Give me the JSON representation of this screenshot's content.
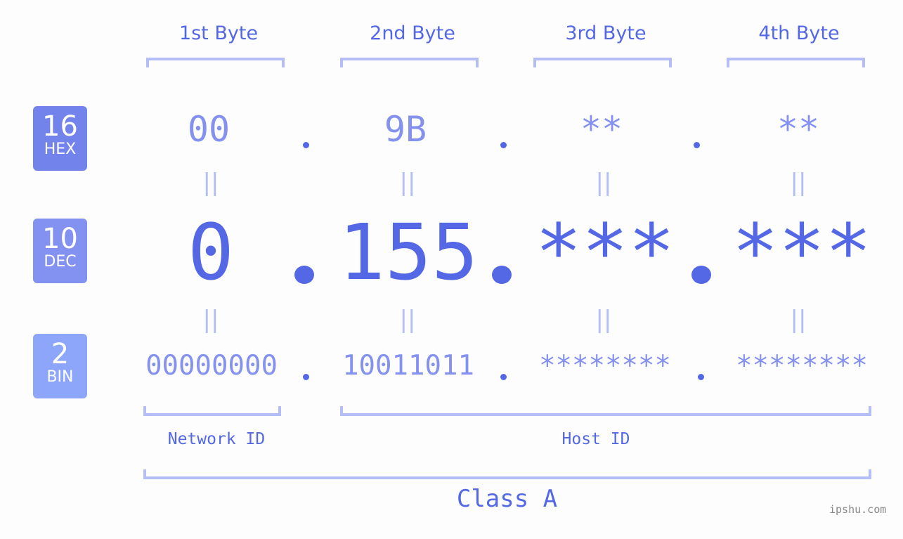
{
  "bytes": [
    {
      "header": "1st Byte",
      "hex": "00",
      "dec": "0",
      "bin": "00000000"
    },
    {
      "header": "2nd Byte",
      "hex": "9B",
      "dec": "155",
      "bin": "10011011"
    },
    {
      "header": "3rd Byte",
      "hex": "**",
      "dec": "***",
      "bin": "********"
    },
    {
      "header": "4th Byte",
      "hex": "**",
      "dec": "***",
      "bin": "********"
    }
  ],
  "badges": {
    "hex": {
      "num": "16",
      "label": "HEX",
      "color": "#7383ec"
    },
    "dec": {
      "num": "10",
      "label": "DEC",
      "color": "#8391f1"
    },
    "bin": {
      "num": "2",
      "label": "BIN",
      "color": "#8ea6fa"
    }
  },
  "equals_symbol": "||",
  "network_id_label": "Network ID",
  "host_id_label": "Host ID",
  "class_label": "Class A",
  "watermark": "ipshu.com",
  "colors": {
    "accent": "#5468e6",
    "light_accent": "#8491ee",
    "bracket": "#b4bdf6",
    "background": "#fcfdfc"
  }
}
